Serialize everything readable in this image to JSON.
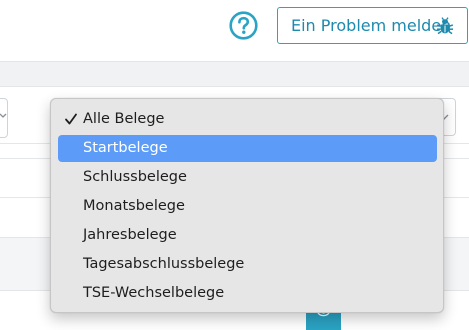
{
  "header": {
    "help_icon": "question-circle-icon",
    "report_button_label": "Ein Problem melden",
    "report_button_icon": "bug-icon"
  },
  "dropdown": {
    "selected": "Alle Belege",
    "highlighted": "Startbelege",
    "options": [
      "Alle Belege",
      "Startbelege",
      "Schlussbelege",
      "Monatsbelege",
      "Jahresbelege",
      "Tagesabschlussbelege",
      "TSE-Wechselbelege"
    ]
  },
  "colors": {
    "accent": "#2aa3c4",
    "menu_highlight": "#5c9cf8",
    "menu_background": "#e6e6e6"
  }
}
